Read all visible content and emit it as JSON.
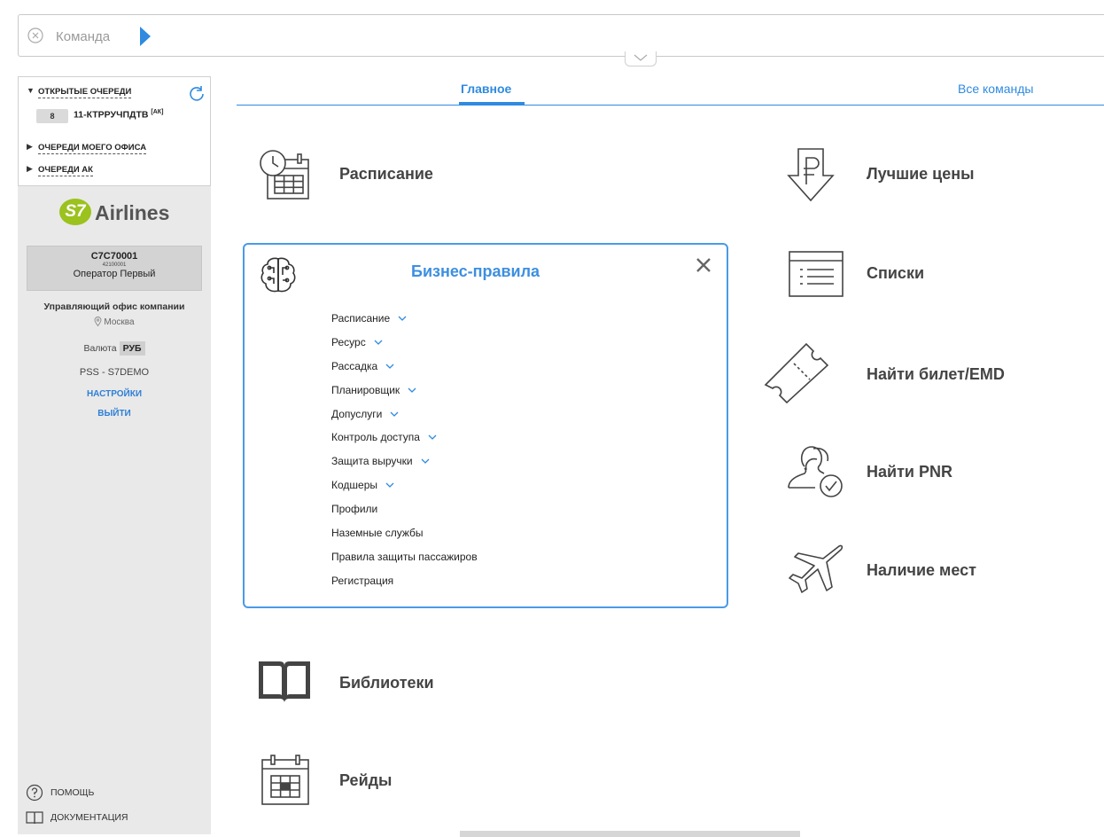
{
  "command": {
    "placeholder": "Команда"
  },
  "queues": {
    "open": {
      "title": "ОТКРЫТЫЕ ОЧЕРЕДИ",
      "item": {
        "count": "8",
        "name": "11-КТРРУЧПДТВ",
        "tag": "[АК]"
      }
    },
    "office": {
      "title": "ОЧЕРЕДИ МОЕГО ОФИСА"
    },
    "airline": {
      "title": "ОЧЕРЕДИ АК"
    }
  },
  "brand": {
    "mark": "S7",
    "name": "Airlines",
    "color": "#9bc21d"
  },
  "user": {
    "code": "C7C70001",
    "id": "42100001",
    "name": "Оператор Первый",
    "office": "Управляющий офис компании",
    "city": "Москва",
    "currency_label": "Валюта",
    "currency": "РУБ",
    "system": "PSS - S7DEMO"
  },
  "links": {
    "settings": "НАСТРОЙКИ",
    "logout": "ВЫЙТИ"
  },
  "bottom": {
    "help": "ПОМОЩЬ",
    "docs": "ДОКУМЕНТАЦИЯ"
  },
  "tabs": {
    "main": "Главное",
    "all": "Все команды"
  },
  "tiles": {
    "schedule": "Расписание",
    "best_prices": "Лучшие цены",
    "lists": "Списки",
    "find_ticket": "Найти билет/EMD",
    "find_pnr": "Найти PNR",
    "availability": "Наличие мест",
    "libraries": "Библиотеки",
    "raids": "Рейды"
  },
  "business_rules": {
    "title": "Бизнес-правила",
    "items": [
      {
        "label": "Расписание",
        "expandable": true
      },
      {
        "label": "Ресурс",
        "expandable": true
      },
      {
        "label": "Рассадка",
        "expandable": true
      },
      {
        "label": "Планировщик",
        "expandable": true
      },
      {
        "label": "Допуслуги",
        "expandable": true
      },
      {
        "label": "Контроль доступа",
        "expandable": true
      },
      {
        "label": "Защита выручки",
        "expandable": true
      },
      {
        "label": "Кодшеры",
        "expandable": true
      },
      {
        "label": "Профили",
        "expandable": false
      },
      {
        "label": "Наземные службы",
        "expandable": false
      },
      {
        "label": "Правила защиты пассажиров",
        "expandable": false
      },
      {
        "label": "Регистрация",
        "expandable": false
      }
    ]
  },
  "accent_color": "#2f8ae0"
}
